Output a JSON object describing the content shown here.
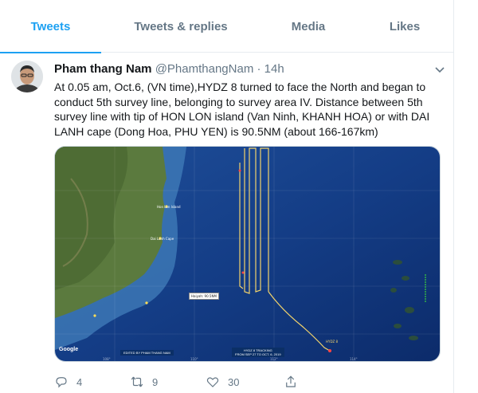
{
  "tabs": [
    {
      "label": "Tweets",
      "active": true
    },
    {
      "label": "Tweets & replies",
      "active": false
    },
    {
      "label": "Media",
      "active": false
    },
    {
      "label": "Likes",
      "active": false
    }
  ],
  "tweet": {
    "author_name": "Pham thang Nam",
    "handle": "@PhamthangNam",
    "separator": "·",
    "time": "14h",
    "text": "At 0.05 am, Oct.6, (VN time),HYDZ 8 turned to face the North and began to conduct 5th survey line, belonging to survey area IV. Distance between 5th survey line with tip of HON LON island (Van Ninh, KHANH HOA) or with DAI LANH cape (Dong Hoa, PHU YEN) is 90.5NM (about 166-167km)",
    "media": {
      "attribution": "Google",
      "banner_left": "EDITED BY PHAM THANG NAM",
      "banner_right_1": "HYDZ 8 TRACKING",
      "banner_right_2": "FROM SEP 27 TO OCT. 6, 2019",
      "label_hon_lon": "Hon Lon Island",
      "label_dai_lanh": "Dai Lanh Cape",
      "label_distance": "Haiyah: 90.5NM",
      "label_ship": "HYDZ 8"
    },
    "stats": {
      "replies": "4",
      "retweets": "9",
      "likes": "30"
    }
  },
  "colors": {
    "accent": "#1da1f2",
    "muted": "#657786",
    "sea_deep": "#0f2e6e",
    "track": "#f2d36b"
  },
  "icons": {
    "reply": "reply-icon",
    "retweet": "retweet-icon",
    "like": "heart-icon",
    "share": "share-icon",
    "caret": "chevron-down-icon"
  }
}
